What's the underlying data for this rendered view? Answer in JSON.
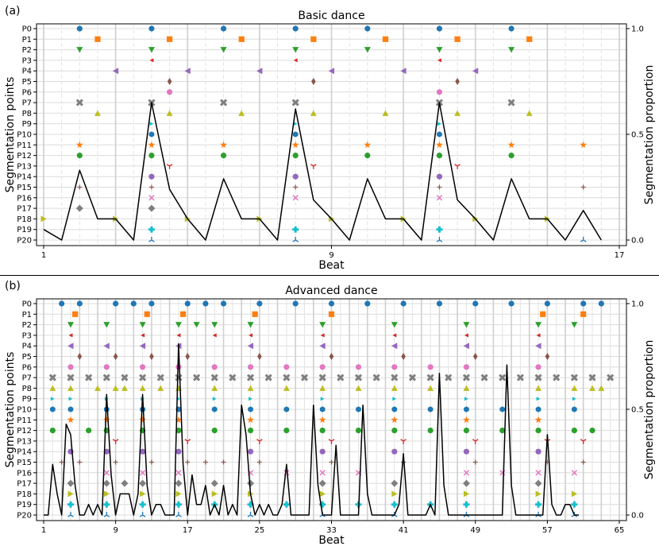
{
  "panels": [
    {
      "tag": "(a)",
      "chart_data": {
        "type": "scatter",
        "title": "Basic dance",
        "xlabel": "Beat",
        "ylabel": "Segmentation points",
        "y2label": "Segmentation proportion",
        "xlim": [
          1,
          17
        ],
        "xticks": [
          "1",
          "9",
          "17"
        ],
        "y2ticks": [
          "0.0",
          "0.5",
          "1.0"
        ],
        "categories": [
          "P0",
          "P1",
          "P2",
          "P3",
          "P4",
          "P5",
          "P6",
          "P7",
          "P8",
          "P9",
          "P10",
          "P11",
          "P12",
          "P13",
          "P14",
          "P15",
          "P16",
          "P17",
          "P18",
          "P19",
          "P20"
        ],
        "points": {
          "P0": [
            2,
            4,
            6,
            8,
            10,
            12,
            14
          ],
          "P1": [
            2.5,
            4.5,
            6.5,
            8.5,
            10.5,
            12.5,
            14.5
          ],
          "P2": [
            2,
            4,
            6,
            8,
            10,
            12,
            14
          ],
          "P3": [
            4,
            8,
            12
          ],
          "P4": [
            3,
            5,
            7,
            9,
            11,
            13
          ],
          "P5": [
            4.5,
            8.5,
            12.5
          ],
          "P6": [
            4.5,
            12
          ],
          "P7": [
            2,
            4,
            6,
            8,
            12,
            14
          ],
          "P8": [
            2.5,
            4.5,
            6.5,
            8.5,
            10.5,
            12.5,
            14.5
          ],
          "P9": [
            4,
            8,
            12
          ],
          "P10": [
            4,
            8,
            12
          ],
          "P11": [
            2,
            4,
            6,
            8,
            10,
            12,
            14,
            16
          ],
          "P12": [
            2,
            4,
            6,
            8,
            10,
            12,
            14
          ],
          "P13": [
            4.5,
            8.5,
            12.5
          ],
          "P14": [
            4,
            8,
            12
          ],
          "P15": [
            2,
            4,
            8,
            12,
            16
          ],
          "P16": [
            4,
            8,
            12
          ],
          "P17": [
            2,
            4
          ],
          "P18": [
            1,
            3,
            5,
            7,
            9,
            11,
            13,
            15
          ],
          "P19": [
            4,
            8,
            12
          ],
          "P20": [
            4,
            8,
            12,
            16
          ]
        },
        "proportion": {
          "x": [
            1,
            1.5,
            2,
            2.5,
            3,
            3.5,
            4,
            4.5,
            5,
            5.5,
            6,
            6.5,
            7,
            7.5,
            8,
            8.5,
            9,
            9.5,
            10,
            10.5,
            11,
            11.5,
            12,
            12.5,
            13,
            13.5,
            14,
            14.5,
            15,
            15.5,
            16,
            16.5
          ],
          "y": [
            0.05,
            0,
            0.33,
            0.1,
            0.1,
            0,
            0.65,
            0.24,
            0.1,
            0,
            0.29,
            0.1,
            0.1,
            0,
            0.62,
            0.19,
            0.1,
            0,
            0.29,
            0.1,
            0.1,
            0,
            0.65,
            0.19,
            0.1,
            0,
            0.29,
            0.1,
            0.1,
            0,
            0.14,
            0
          ]
        },
        "grid": true
      }
    },
    {
      "tag": "(b)",
      "chart_data": {
        "type": "scatter",
        "title": "Advanced dance",
        "xlabel": "Beat",
        "ylabel": "Segmentation points",
        "y2label": "Segmentation proportion",
        "xlim": [
          1,
          65
        ],
        "xticks": [
          "1",
          "9",
          "17",
          "25",
          "33",
          "41",
          "49",
          "57",
          "65"
        ],
        "y2ticks": [
          "0.0",
          "0.5",
          "1.0"
        ],
        "categories": [
          "P0",
          "P1",
          "P2",
          "P3",
          "P4",
          "P5",
          "P6",
          "P7",
          "P8",
          "P9",
          "P10",
          "P11",
          "P12",
          "P13",
          "P14",
          "P15",
          "P16",
          "P17",
          "P18",
          "P19",
          "P20"
        ],
        "points": {
          "P0": [
            3,
            5,
            9,
            11,
            13,
            17,
            19,
            21,
            25,
            29,
            33,
            37,
            41,
            45,
            49,
            53,
            57,
            61,
            63
          ],
          "P1": [
            4.5,
            12.5,
            16.5,
            24.5,
            33,
            56.5,
            61
          ],
          "P2": [
            4,
            8,
            12,
            16,
            18,
            20,
            24,
            32,
            40,
            48,
            56,
            60
          ],
          "P3": [
            4,
            12,
            16,
            20,
            24,
            32,
            40,
            48,
            56
          ],
          "P4": [
            4,
            8,
            12,
            16,
            24,
            32,
            40,
            48,
            56
          ],
          "P5": [
            5,
            9,
            13,
            17,
            25,
            33,
            41,
            49,
            57
          ],
          "P6": [
            4,
            8,
            12,
            16,
            20,
            24,
            28,
            32,
            36,
            40,
            44,
            48,
            56
          ],
          "P7": [
            2,
            4,
            6,
            8,
            10,
            12,
            14,
            16,
            18,
            20,
            22,
            24,
            26,
            28,
            30,
            32,
            34,
            36,
            38,
            40,
            42,
            44,
            46,
            48,
            50,
            52,
            54,
            56,
            58,
            60,
            62,
            64
          ],
          "P8": [
            2,
            4,
            7,
            9,
            10,
            12,
            14,
            16,
            20,
            24,
            28,
            32,
            36,
            40,
            44,
            48,
            56,
            60,
            62,
            63
          ],
          "P9": [
            2,
            4,
            8,
            12,
            16,
            20,
            24,
            32,
            40,
            48,
            56,
            60
          ],
          "P10": [
            2,
            4,
            8,
            12,
            16,
            20,
            24,
            28,
            32,
            36,
            40,
            44,
            48,
            52,
            56,
            60
          ],
          "P11": [
            4,
            8,
            12,
            16,
            24,
            32,
            40,
            48,
            56
          ],
          "P12": [
            2,
            6,
            8,
            12,
            16,
            20,
            24,
            28,
            32,
            36,
            40,
            44,
            48,
            52,
            56,
            60,
            62
          ],
          "P13": [
            9,
            17,
            25,
            33,
            41,
            49,
            57,
            61
          ],
          "P14": [
            4,
            8,
            12,
            16,
            24,
            32,
            40,
            48,
            56
          ],
          "P15": [
            3,
            5,
            9,
            13,
            17,
            19,
            21,
            25,
            33,
            41,
            49,
            57,
            61
          ],
          "P16": [
            8,
            12,
            16,
            24,
            28,
            32,
            36,
            48,
            52,
            56,
            60
          ],
          "P17": [
            4,
            8,
            10,
            12,
            16,
            20,
            24,
            32,
            40,
            48,
            56
          ],
          "P18": [
            4,
            8,
            12,
            16,
            20,
            24,
            32,
            40,
            48,
            56,
            60
          ],
          "P19": [
            4,
            8,
            12,
            16,
            20,
            24,
            28,
            32,
            36,
            40,
            44,
            48,
            56,
            60
          ],
          "P20": [
            4,
            8,
            12,
            16,
            24,
            32,
            40,
            48,
            56,
            60
          ]
        },
        "proportion": {
          "x": [
            1,
            1.5,
            2,
            2.5,
            3,
            3.5,
            4,
            4.5,
            5,
            5.5,
            6,
            6.5,
            7,
            7.5,
            8,
            8.5,
            9,
            9.5,
            10,
            10.5,
            11,
            11.5,
            12,
            12.5,
            13,
            13.5,
            14,
            14.5,
            15,
            15.5,
            16,
            16.5,
            17,
            17.5,
            18,
            18.5,
            19,
            19.5,
            20,
            20.5,
            21,
            21.5,
            22,
            22.5,
            23,
            23.5,
            24,
            24.5,
            25,
            25.5,
            26,
            26.5,
            27,
            27.5,
            28,
            28.5,
            29,
            29.5,
            30,
            30.5,
            31,
            31.5,
            32,
            32.5,
            33,
            33.5,
            34,
            34.5,
            35,
            35.5,
            36,
            36.5,
            37,
            37.5,
            38,
            38.5,
            39,
            39.5,
            40,
            40.5,
            41,
            41.5,
            42,
            42.5,
            43,
            43.5,
            44,
            44.5,
            45,
            45.5,
            46,
            46.5,
            47,
            47.5,
            48,
            48.5,
            49,
            49.5,
            50,
            50.5,
            51,
            51.5,
            52,
            52.5,
            53,
            53.5,
            54,
            54.5,
            55,
            55.5,
            56,
            56.5,
            57,
            57.5,
            58,
            58.5,
            59,
            59.5,
            60,
            60.5,
            61,
            61.5,
            62,
            62.5,
            63,
            63.5,
            64,
            64.5
          ],
          "y": [
            0,
            0,
            0.24,
            0.1,
            0,
            0.43,
            0.38,
            0.14,
            0,
            0,
            0.05,
            0,
            0.05,
            0,
            0.57,
            0.19,
            0,
            0.1,
            0.1,
            0.1,
            0,
            0.1,
            0.57,
            0.14,
            0,
            0.05,
            0.05,
            0,
            0,
            0,
            0.81,
            0.24,
            0,
            0.19,
            0.05,
            0.05,
            0.14,
            0,
            0.05,
            0,
            0.14,
            0,
            0.05,
            0,
            0.52,
            0.38,
            0.1,
            0,
            0.05,
            0,
            0.05,
            0,
            0,
            0.05,
            0.24,
            0,
            0,
            0,
            0,
            0,
            0.52,
            0.14,
            0,
            0,
            0,
            0.33,
            0,
            0,
            0,
            0,
            0,
            0.52,
            0.1,
            0,
            0,
            0,
            0,
            0,
            0,
            0.05,
            0.29,
            0,
            0,
            0,
            0,
            0,
            0.05,
            0,
            0.67,
            0.14,
            0,
            0,
            0,
            0,
            0,
            0,
            0,
            0,
            0,
            0,
            0,
            0,
            0,
            0.71,
            0.14,
            0,
            0,
            0,
            0,
            0,
            0,
            0,
            0.38,
            0.05,
            0,
            0,
            0.05,
            0.05,
            0,
            0
          ],
          "note": ""
        },
        "grid": true
      }
    }
  ],
  "marker_colors": [
    "#1f77b4",
    "#ff7f0e",
    "#2ca02c",
    "#d62728",
    "#9467bd",
    "#8c564b",
    "#e377c2",
    "#7f7f7f",
    "#bcbd22",
    "#17becf"
  ],
  "line_color": "#000000"
}
